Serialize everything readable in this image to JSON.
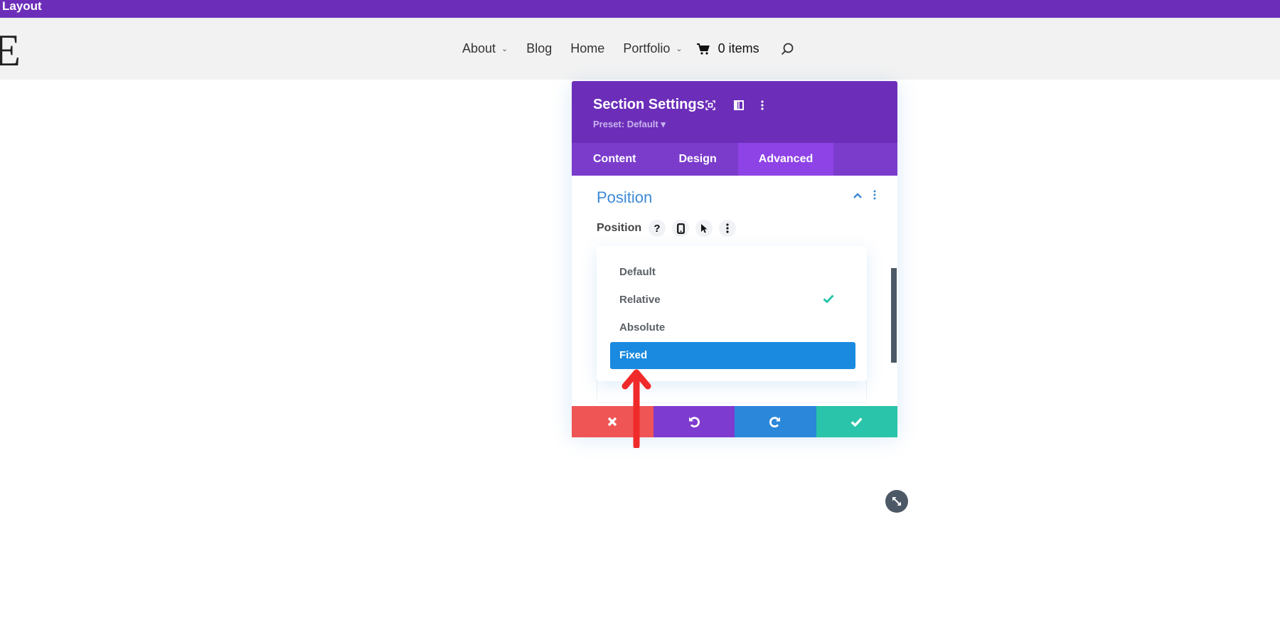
{
  "topbar": {
    "title": "Layout"
  },
  "site": {
    "logo_letter": "E",
    "nav": [
      {
        "label": "About",
        "has_dropdown": true
      },
      {
        "label": "Blog",
        "has_dropdown": false
      },
      {
        "label": "Home",
        "has_dropdown": false
      },
      {
        "label": "Portfolio",
        "has_dropdown": true
      }
    ],
    "cart": {
      "label": "0 items",
      "icon": "cart-icon"
    },
    "search_icon": "search-icon"
  },
  "modal": {
    "title": "Section Settings",
    "preset": "Preset: Default ▾",
    "header_icons": [
      "fullscreen-icon",
      "sidebar-layout-icon",
      "more-vertical-icon"
    ],
    "tabs": [
      {
        "label": "Content",
        "active": false
      },
      {
        "label": "Design",
        "active": false
      },
      {
        "label": "Advanced",
        "active": true
      }
    ],
    "section": {
      "title": "Position",
      "field_label": "Position",
      "field_icons": [
        "help-icon",
        "mobile-icon",
        "hover-cursor-icon",
        "more-vertical-icon"
      ],
      "dropdown": {
        "options": [
          {
            "label": "Default",
            "checked": false,
            "highlighted": false
          },
          {
            "label": "Relative",
            "checked": true,
            "highlighted": false
          },
          {
            "label": "Absolute",
            "checked": false,
            "highlighted": false
          },
          {
            "label": "Fixed",
            "checked": false,
            "highlighted": true
          }
        ]
      }
    },
    "footer": {
      "buttons": [
        {
          "name": "cancel",
          "icon": "close-icon",
          "color": "#ef5555"
        },
        {
          "name": "undo",
          "icon": "undo-icon",
          "color": "#7e3bd0"
        },
        {
          "name": "redo",
          "icon": "redo-icon",
          "color": "#2b87da"
        },
        {
          "name": "save",
          "icon": "check-icon",
          "color": "#29c4a9"
        }
      ]
    }
  },
  "colors": {
    "brand_purple": "#6c2eb9",
    "tab_bar": "#7b3ccc",
    "tab_active": "#8e43e6",
    "accent_blue": "#2b87da",
    "highlight_blue": "#198ae0",
    "check_green": "#29c4a9",
    "annotation_red": "#f02a2a"
  }
}
